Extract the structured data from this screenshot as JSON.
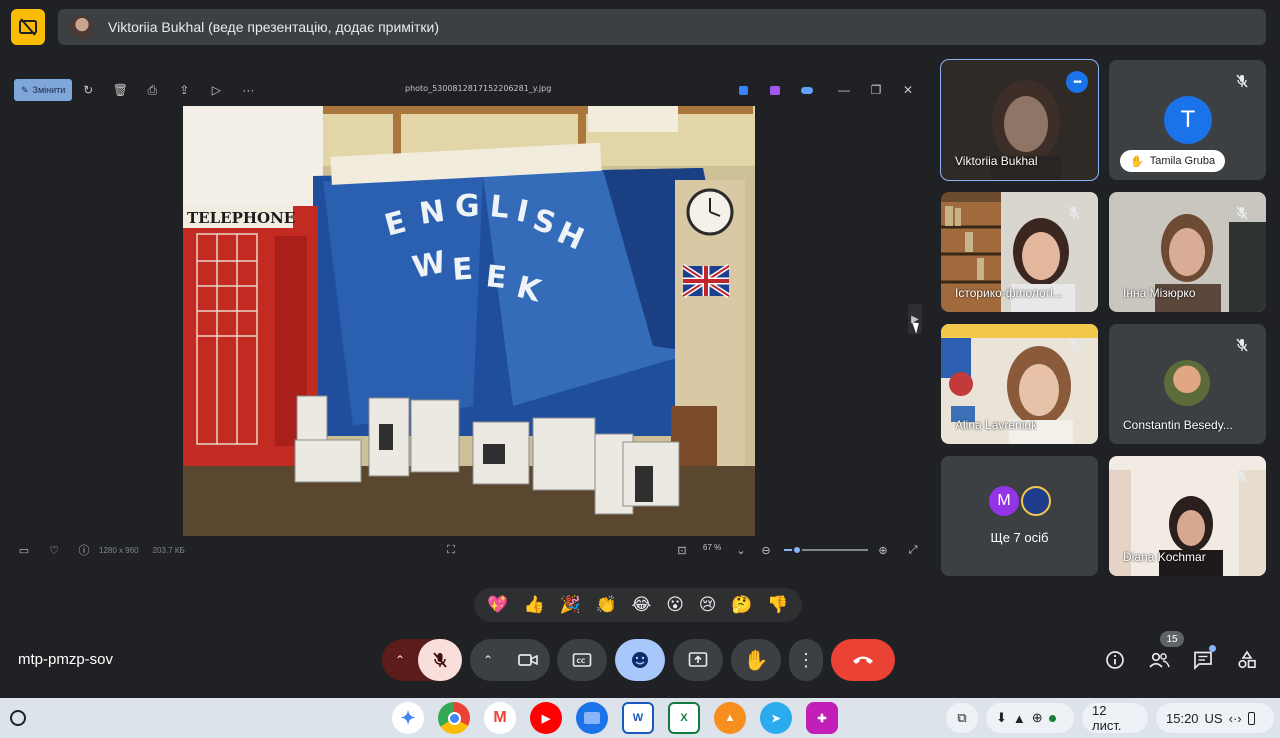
{
  "presenter_bar": {
    "title": "Viktoriia Bukhal (веде презентацію, додає примітки)"
  },
  "viewer": {
    "edit_label": "Змінити",
    "file_name": "photo_5300812817152206281_y.jpg",
    "image_size": "1280 x 960",
    "file_size": "203.7 КБ",
    "zoom": "67 %",
    "zoom_level": 0.15
  },
  "participants": [
    {
      "name": "Viktoriia Bukhal",
      "speaking": true
    },
    {
      "name": "Tamila Gruba",
      "initial": "T",
      "hand_raised": true
    },
    {
      "name": "Історико-філологі...",
      "muted": true
    },
    {
      "name": "Інна Мізюрко",
      "muted": true
    },
    {
      "name": "Alina Lavreniuk",
      "muted": true
    },
    {
      "name": "Constantin Besedy...",
      "muted": true
    },
    {
      "name": "Ще 7 осіб",
      "initial": "M"
    },
    {
      "name": "Diana Kochmar",
      "muted": true
    }
  ],
  "reactions": [
    "💖",
    "👍",
    "🎉",
    "👏",
    "😂",
    "😮",
    "😢",
    "🤔",
    "👎"
  ],
  "meeting": {
    "code": "mtp-pmzp-sov",
    "participant_count": "15"
  },
  "taskbar": {
    "apps": [
      "Gemini",
      "Chrome",
      "Gmail",
      "YouTube",
      "Files",
      "Word",
      "Excel",
      "VLC",
      "Telegram",
      "Canvas"
    ],
    "date": "12 лист.",
    "time": "15:20",
    "locale": "US"
  },
  "colors": {
    "background": "#202124",
    "tile": "#3c4043",
    "accent": "#8ab4f8",
    "end_call": "#ea4335",
    "mic_off": "#f9dedc",
    "reactions_active": "#a8c7fa"
  }
}
